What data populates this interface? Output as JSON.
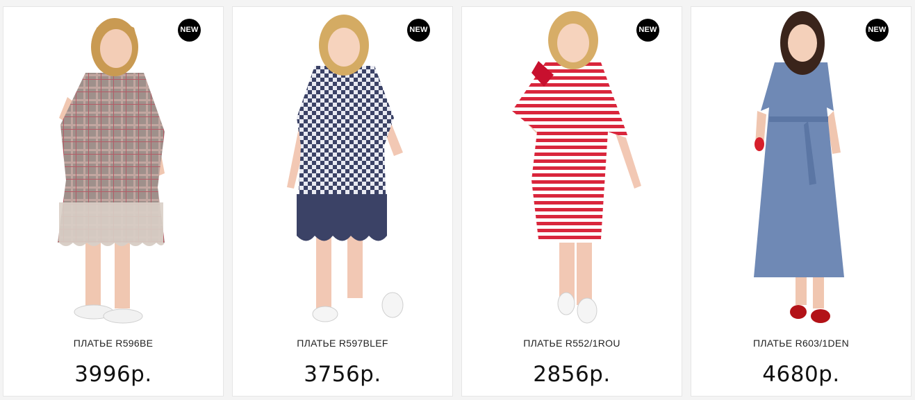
{
  "products": [
    {
      "badge": "NEW",
      "title": "ПЛАТЬЕ R596BE",
      "price": "3996р.",
      "image_icon": "product-photo-plaid-dress",
      "dress_color": "#9a8a86",
      "accent_color": "#c9b9b0",
      "hair_color": "#c99a52"
    },
    {
      "badge": "NEW",
      "title": "ПЛАТЬЕ R597BLEF",
      "price": "3756р.",
      "image_icon": "product-photo-checkered-dress",
      "dress_color": "#3b4266",
      "accent_color": "#e9eaf2",
      "hair_color": "#d4ab63"
    },
    {
      "badge": "NEW",
      "title": "ПЛАТЬЕ R552/1ROU",
      "price": "2856р.",
      "image_icon": "product-photo-striped-dress",
      "dress_color": "#d9263c",
      "accent_color": "#ffffff",
      "hair_color": "#d7ad67"
    },
    {
      "badge": "NEW",
      "title": "ПЛАТЬЕ R603/1DEN",
      "price": "4680р.",
      "image_icon": "product-photo-denim-dress",
      "dress_color": "#6b86b3",
      "accent_color": "#8aa0c6",
      "hair_color": "#3a241b"
    }
  ]
}
